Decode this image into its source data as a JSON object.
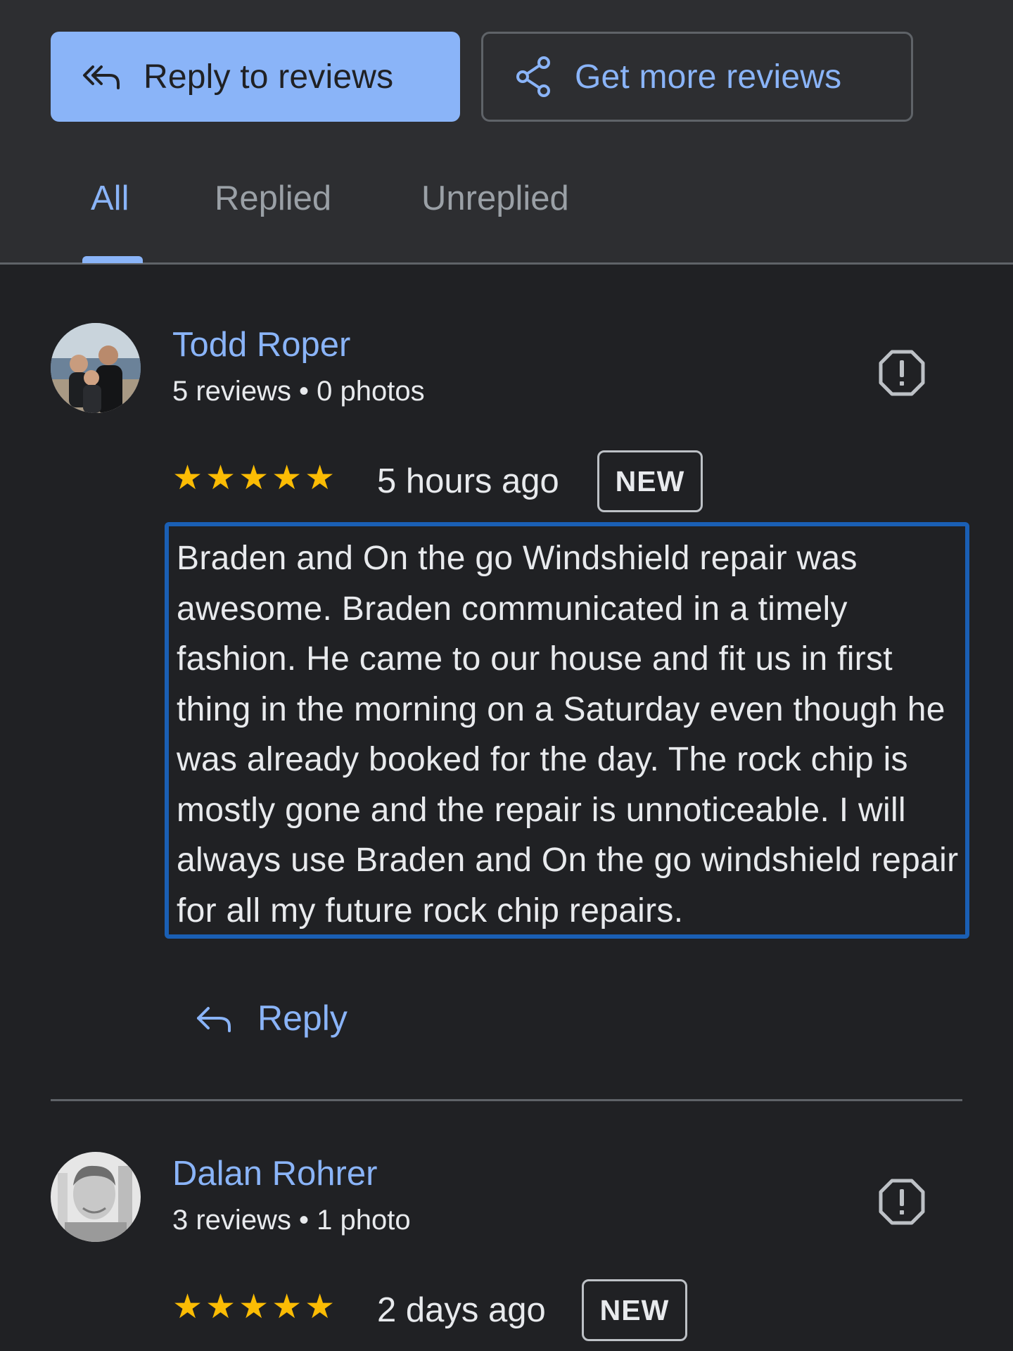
{
  "actions": {
    "reply_to_reviews": "Reply to reviews",
    "get_more_reviews": "Get more reviews"
  },
  "tabs": [
    {
      "label": "All",
      "active": true
    },
    {
      "label": "Replied",
      "active": false
    },
    {
      "label": "Unreplied",
      "active": false
    }
  ],
  "reviews": [
    {
      "name": "Todd Roper",
      "meta": "5 reviews • 0 photos",
      "rating": 5,
      "time": "5 hours ago",
      "badge": "NEW",
      "text": "Braden and On the go Windshield repair was awesome. Braden communicated in a timely fashion. He came to our house and fit us in first thing in the morning on a Saturday even though he was already booked for the day. The rock chip is mostly gone and the repair is unnoticeable. I will always use Braden and On the go windshield repair for all my future rock chip repairs.",
      "reply_label": "Reply"
    },
    {
      "name": "Dalan Rohrer",
      "meta": "3 reviews • 1 photo",
      "rating": 5,
      "time": "2 days ago",
      "badge": "NEW"
    }
  ],
  "icons": {
    "reply_all": "reply-all-icon",
    "share": "share-icon",
    "report": "report-flag-icon",
    "star": "star-icon",
    "reply": "reply-icon"
  },
  "colors": {
    "accent": "#8ab4f8",
    "star": "#fbbc04",
    "background": "#202124",
    "header": "#2d2e31",
    "focus_border": "#1a5fb4"
  }
}
